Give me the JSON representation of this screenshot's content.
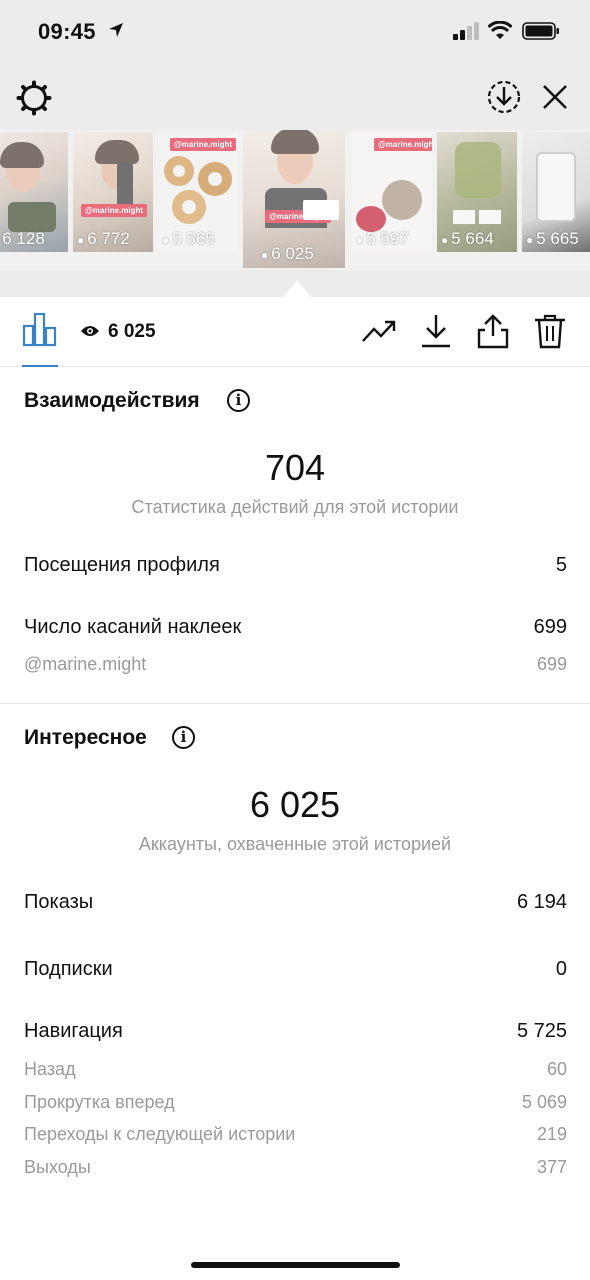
{
  "status_bar": {
    "time": "09:45"
  },
  "stories": [
    {
      "views": "6 128",
      "tag": ""
    },
    {
      "views": "6 772",
      "tag": "@marine.might"
    },
    {
      "views": "5 565",
      "tag": "@marine.might"
    },
    {
      "views": "6 025",
      "tag": "@marine.might",
      "selected": true
    },
    {
      "views": "5 597",
      "tag": "@marine.might"
    },
    {
      "views": "5 664",
      "tag": ""
    },
    {
      "views": "5 665",
      "tag": ""
    }
  ],
  "tabs": {
    "views_count": "6 025"
  },
  "interactions": {
    "title": "Взаимодействия",
    "total": "704",
    "total_caption": "Статистика действий для этой истории",
    "rows": [
      {
        "label": "Посещения профиля",
        "value": "5"
      },
      {
        "label": "Число касаний наклеек",
        "value": "699"
      }
    ],
    "sub_rows": [
      {
        "label": "@marine.might",
        "value": "699"
      }
    ]
  },
  "discovery": {
    "title": "Интересное",
    "total": "6 025",
    "total_caption": "Аккаунты, охваченные этой историей",
    "rows": [
      {
        "label": "Показы",
        "value": "6 194"
      },
      {
        "label": "Подписки",
        "value": "0"
      },
      {
        "label": "Навигация",
        "value": "5 725"
      }
    ],
    "sub_rows": [
      {
        "label": "Назад",
        "value": "60"
      },
      {
        "label": "Прокрутка вперед",
        "value": "5 069"
      },
      {
        "label": "Переходы к следующей истории",
        "value": "219"
      },
      {
        "label": "Выходы",
        "value": "377"
      }
    ]
  },
  "icons": {
    "status": [
      "location-arrow-icon",
      "signal-bars-icon",
      "wifi-icon",
      "battery-icon"
    ],
    "top": [
      "settings-gear-icon",
      "download-circle-icon",
      "close-icon"
    ],
    "actions": [
      "bar-chart-icon",
      "eye-icon",
      "trending-up-icon",
      "download-icon",
      "share-icon",
      "trash-icon"
    ]
  },
  "colors": {
    "accent": "#3b82c4",
    "tag_red": "#e0344a",
    "muted_text": "#9a9a9a"
  }
}
